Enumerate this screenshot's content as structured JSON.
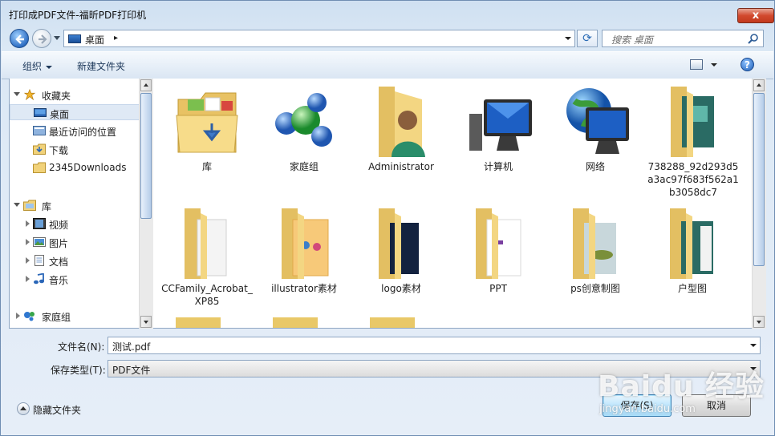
{
  "window": {
    "title": "打印成PDF文件-福昕PDF打印机",
    "close": "x"
  },
  "nav": {
    "address": "桌面",
    "address_sep": "▸",
    "search_placeholder": "搜索 桌面",
    "refresh": "⟳"
  },
  "toolbar": {
    "organize": "组织",
    "new_folder": "新建文件夹",
    "help": "?"
  },
  "sidebar": {
    "favorites": "收藏夹",
    "fav_items": [
      {
        "label": "桌面",
        "icon": "desktop-icon"
      },
      {
        "label": "最近访问的位置",
        "icon": "recent-places-icon"
      },
      {
        "label": "下载",
        "icon": "downloads-folder-icon"
      },
      {
        "label": "2345Downloads",
        "icon": "folder-icon"
      }
    ],
    "libraries": "库",
    "lib_items": [
      {
        "label": "视频",
        "icon": "video-library-icon"
      },
      {
        "label": "图片",
        "icon": "pictures-library-icon"
      },
      {
        "label": "文档",
        "icon": "documents-library-icon"
      },
      {
        "label": "音乐",
        "icon": "music-library-icon"
      }
    ],
    "homegroup": "家庭组"
  },
  "files": [
    {
      "name": "库",
      "icon": "libraries-icon"
    },
    {
      "name": "家庭组",
      "icon": "homegroup-icon"
    },
    {
      "name": "Administrator",
      "icon": "user-folder-icon"
    },
    {
      "name": "计算机",
      "icon": "computer-icon"
    },
    {
      "name": "网络",
      "icon": "network-icon"
    },
    {
      "name": "738288_92d293d5a3ac97f683f562a1b3058dc7",
      "icon": "folder-icon"
    },
    {
      "name": "CCFamily_Acrobat_XP85",
      "icon": "folder-icon"
    },
    {
      "name": "illustrator素材",
      "icon": "folder-icon"
    },
    {
      "name": "logo素材",
      "icon": "folder-icon"
    },
    {
      "name": "PPT",
      "icon": "folder-icon"
    },
    {
      "name": "ps创意制图",
      "icon": "folder-icon"
    },
    {
      "name": "户型图",
      "icon": "folder-icon"
    }
  ],
  "form": {
    "filename_label": "文件名(N):",
    "filename_value": "测试.pdf",
    "filetype_label": "保存类型(T):",
    "filetype_value": "PDF文件",
    "hide_folders": "隐藏文件夹",
    "save": "保存(S)",
    "cancel": "取消"
  },
  "watermark": {
    "brand": "Baidu 经验",
    "url": "jingyan.baidu.com"
  },
  "colors": {
    "accent": "#2f6fc4",
    "folder": "#f6d77b",
    "selection": "#dfe9f5"
  }
}
